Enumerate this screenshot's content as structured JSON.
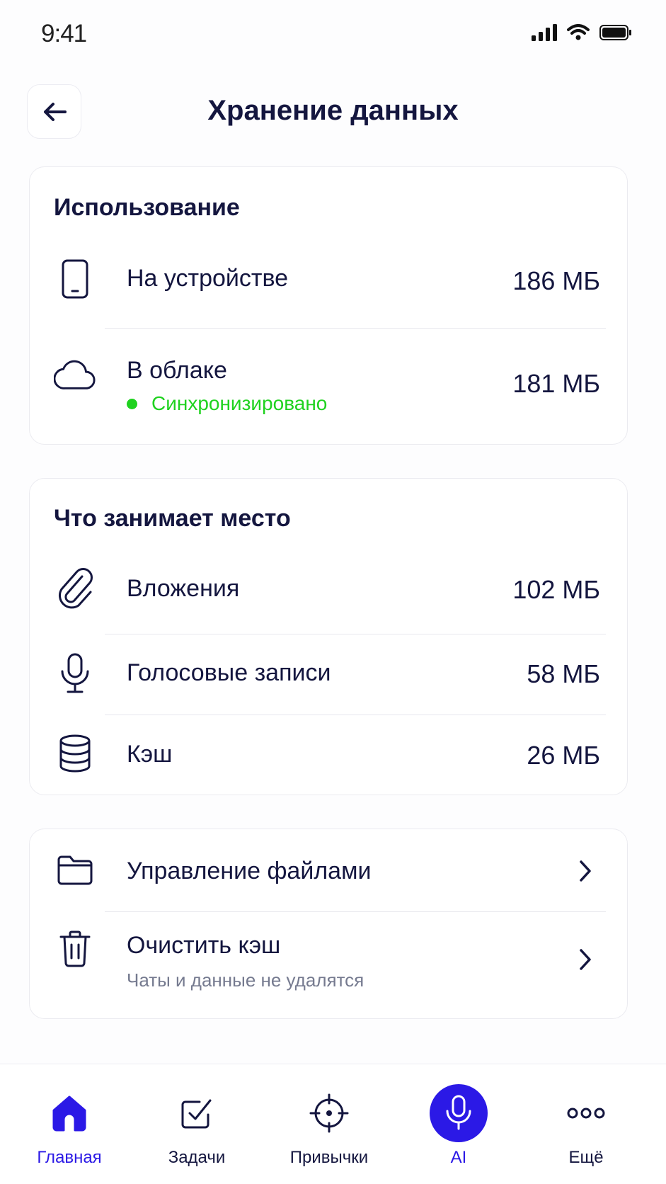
{
  "status_bar": {
    "time": "9:41"
  },
  "header": {
    "title": "Хранение данных"
  },
  "usage": {
    "title": "Использование",
    "device": {
      "label": "На устройстве",
      "value": "186 МБ",
      "icon": "smartphone-icon"
    },
    "cloud": {
      "label": "В облаке",
      "value": "181 МБ",
      "status": "Синхронизировано",
      "icon": "cloud-icon"
    }
  },
  "space": {
    "title": "Что занимает место",
    "items": [
      {
        "label": "Вложения",
        "value": "102 МБ",
        "icon": "paperclip-icon"
      },
      {
        "label": "Голосовые записи",
        "value": "58 МБ",
        "icon": "microphone-icon"
      },
      {
        "label": "Кэш",
        "value": "26 МБ",
        "icon": "database-icon"
      }
    ]
  },
  "actions": {
    "manage_files": {
      "label": "Управление файлами",
      "icon": "folder-icon"
    },
    "clear_cache": {
      "label": "Очистить кэш",
      "subtitle": "Чаты и данные не удалятся",
      "icon": "trash-icon"
    }
  },
  "tabbar": {
    "tabs": [
      {
        "label": "Главная",
        "icon": "home-icon",
        "active": true
      },
      {
        "label": "Задачи",
        "icon": "checkbox-icon",
        "active": false
      },
      {
        "label": "Привычки",
        "icon": "target-icon",
        "active": false
      },
      {
        "label": "AI",
        "icon": "microphone-icon",
        "active": false
      },
      {
        "label": "Ещё",
        "icon": "more-icon",
        "active": false
      }
    ]
  },
  "colors": {
    "text": "#14163f",
    "accent": "#2b19e6",
    "success": "#1fd21f",
    "muted": "#757a8f"
  }
}
